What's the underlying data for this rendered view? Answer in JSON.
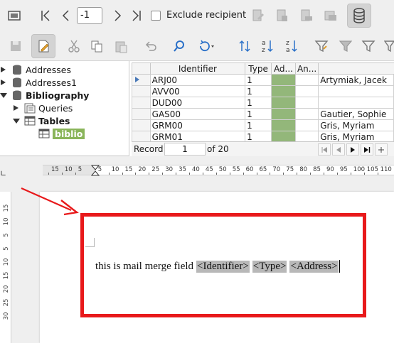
{
  "toolbar_top": {
    "record_value": "-1",
    "exclude_recipient_label": "Exclude recipient"
  },
  "data_sources": {
    "items": [
      {
        "label": "Addresses"
      },
      {
        "label": "Addresses1"
      },
      {
        "label": "Bibliography"
      },
      {
        "label": "Queries"
      },
      {
        "label": "Tables"
      },
      {
        "label": "biblio"
      }
    ]
  },
  "grid": {
    "columns": [
      "Identifier",
      "Type",
      "Ad...",
      "An..."
    ],
    "rows": [
      {
        "identifier": "ARJ00",
        "type": "1",
        "author": "Artymiak, Jacek"
      },
      {
        "identifier": "AVV00",
        "type": "1",
        "author": ""
      },
      {
        "identifier": "DUD00",
        "type": "1",
        "author": ""
      },
      {
        "identifier": "GAS00",
        "type": "1",
        "author": "Gautier, Sophie"
      },
      {
        "identifier": "GRM00",
        "type": "1",
        "author": "Gris, Myriam"
      },
      {
        "identifier": "GRM01",
        "type": "1",
        "author": "Gris, Myriam"
      }
    ],
    "record_label": "Record",
    "record_number": "1",
    "record_total": "of 20"
  },
  "ruler": {
    "labels": [
      "15",
      "10",
      "5",
      "5",
      "10",
      "15",
      "20",
      "25",
      "30",
      "35",
      "40",
      "45",
      "50",
      "55",
      "60",
      "65",
      "70",
      "75",
      "80",
      "85",
      "90",
      "95",
      "100",
      "105",
      "110"
    ]
  },
  "vertical_ruler": {
    "labels": [
      "15",
      "10",
      "5",
      "5",
      "10",
      "15",
      "20",
      "25",
      "30"
    ]
  },
  "document": {
    "text": "this is mail merge field",
    "fields": [
      "<Identifier>",
      "<Type>",
      "<Address>"
    ]
  },
  "colors": {
    "accent_green": "#8ab55a",
    "annotation_red": "#e8191b",
    "field_gray": "#b8b8b8"
  },
  "icons": [
    "mail-merge-view-icon",
    "first-record-icon",
    "previous-record-icon",
    "next-record-icon",
    "last-record-icon",
    "edit-document-icon",
    "save-document-icon",
    "print-document-icon",
    "send-email-icon",
    "data-source-icon",
    "save-icon",
    "edit-icon",
    "cut-icon",
    "copy-icon",
    "paste-icon",
    "undo-icon",
    "find-icon",
    "refresh-icon",
    "sort-icon",
    "sort-ascending-icon",
    "sort-descending-icon",
    "autofilter-icon",
    "standard-filter-icon",
    "reset-filter-icon"
  ]
}
